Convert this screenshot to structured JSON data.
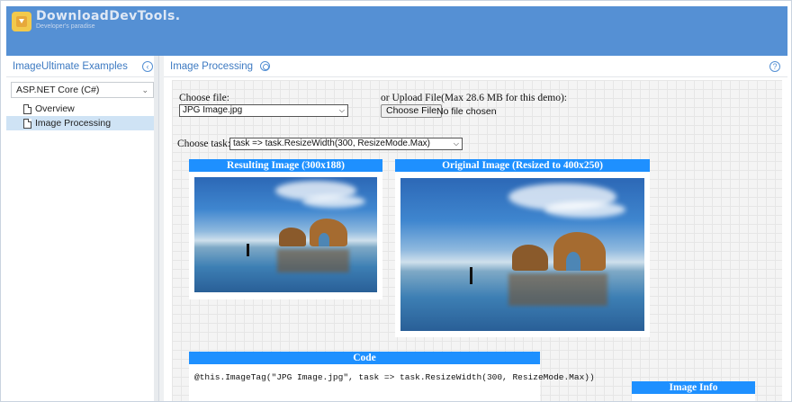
{
  "brand": {
    "name": "DownloadDevTools.",
    "tagline": "Developer's paradise"
  },
  "sidebar": {
    "title": "ImageUltimate Examples",
    "collapse_icon": "chevron-left-icon",
    "framework_select": "ASP.NET Core (C#)",
    "items": [
      {
        "label": "Overview",
        "icon": "document-icon",
        "active": false
      },
      {
        "label": "Image Processing",
        "icon": "document-icon",
        "active": true
      }
    ]
  },
  "main": {
    "title": "Image Processing",
    "help_icon": "question-mark-icon",
    "form": {
      "choose_file_label": "Choose file:",
      "file_select_value": "JPG Image.jpg",
      "upload_label": "or Upload File(Max 28.6 MB for this demo):",
      "choose_file_button": "Choose File",
      "file_status": "No file chosen",
      "choose_task_label": "Choose task:",
      "task_select_value": "task => task.ResizeWidth(300, ResizeMode.Max)"
    },
    "result_card": {
      "title": "Resulting Image (300x188)"
    },
    "original_card": {
      "title": "Original Image (Resized to 400x250)"
    },
    "code_card": {
      "title": "Code",
      "code": "@this.ImageTag(\"JPG Image.jpg\", task => task.ResizeWidth(300, ResizeMode.Max))"
    },
    "info_card": {
      "title": "Image Info"
    }
  },
  "colors": {
    "banner": "#5590d4",
    "accent_text": "#3d7ac2",
    "card_header": "#1e90ff",
    "sidebar_active": "#cfe3f5"
  }
}
